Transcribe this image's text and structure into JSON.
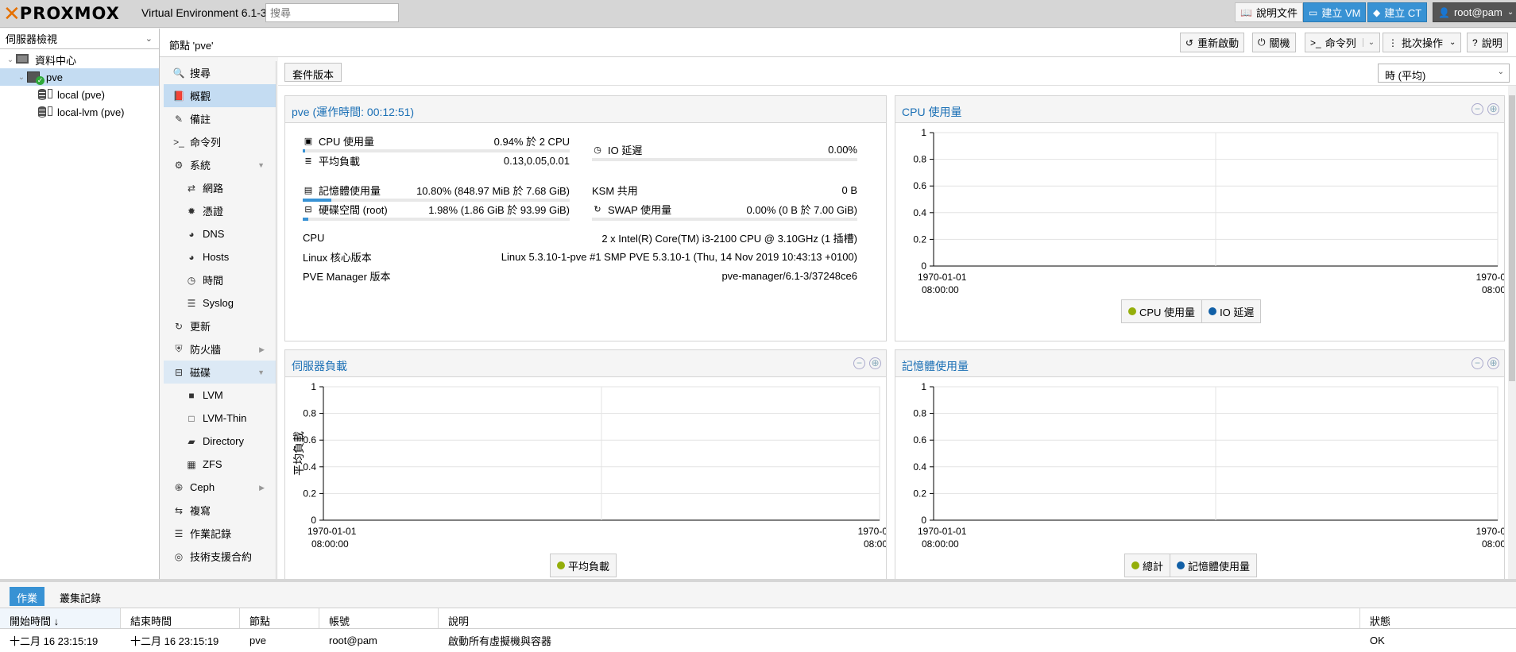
{
  "topbar": {
    "logo_text": "PROXMOX",
    "version": "Virtual Environment 6.1-3",
    "search_placeholder": "搜尋",
    "docs_label": "說明文件",
    "create_vm_label": "建立 VM",
    "create_ct_label": "建立 CT",
    "user_label": "root@pam"
  },
  "tree": {
    "view_label": "伺服器檢視",
    "items": [
      {
        "label": "資料中心"
      },
      {
        "label": "pve"
      },
      {
        "label": "local (pve)"
      },
      {
        "label": "local-lvm (pve)"
      }
    ]
  },
  "header": {
    "title": "節點 'pve'",
    "reboot": "重新啟動",
    "shutdown": "關機",
    "shell": "命令列",
    "bulk": "批次操作",
    "help": "說明"
  },
  "nav": {
    "items": [
      {
        "label": "搜尋",
        "icon": "search-icon"
      },
      {
        "label": "概觀",
        "icon": "book-icon"
      },
      {
        "label": "備註",
        "icon": "note-icon"
      },
      {
        "label": "命令列",
        "icon": "terminal-icon"
      },
      {
        "label": "系統",
        "icon": "cogs-icon"
      },
      {
        "label": "網路",
        "icon": "exchange-icon"
      },
      {
        "label": "憑證",
        "icon": "certificate-icon"
      },
      {
        "label": "DNS",
        "icon": "globe-icon"
      },
      {
        "label": "Hosts",
        "icon": "globe-icon"
      },
      {
        "label": "時間",
        "icon": "clock-icon"
      },
      {
        "label": "Syslog",
        "icon": "list-icon"
      },
      {
        "label": "更新",
        "icon": "refresh-icon"
      },
      {
        "label": "防火牆",
        "icon": "shield-icon"
      },
      {
        "label": "磁碟",
        "icon": "hdd-icon"
      },
      {
        "label": "LVM",
        "icon": "square-icon"
      },
      {
        "label": "LVM-Thin",
        "icon": "square-outline-icon"
      },
      {
        "label": "Directory",
        "icon": "folder-icon"
      },
      {
        "label": "ZFS",
        "icon": "grid-icon"
      },
      {
        "label": "Ceph",
        "icon": "ceph-icon"
      },
      {
        "label": "複寫",
        "icon": "retweet-icon"
      },
      {
        "label": "作業記錄",
        "icon": "list-icon"
      },
      {
        "label": "技術支援合約",
        "icon": "lifering-icon"
      }
    ]
  },
  "content": {
    "package_versions": "套件版本",
    "timeframe": "時 (平均)"
  },
  "summary": {
    "title": "pve (運作時間: 00:12:51)",
    "cpu_label": "CPU 使用量",
    "cpu_value": "0.94% 於 2 CPU",
    "cpu_pct": 0.94,
    "load_label": "平均負載",
    "load_value": "0.13,0.05,0.01",
    "io_label": "IO 延遲",
    "io_value": "0.00%",
    "mem_label": "記憶體使用量",
    "mem_value": "10.80% (848.97 MiB 於 7.68 GiB)",
    "mem_pct": 10.8,
    "ksm_label": "KSM 共用",
    "ksm_value": "0 B",
    "disk_label": "硬碟空間 (root)",
    "disk_value": "1.98% (1.86 GiB 於 93.99 GiB)",
    "disk_pct": 1.98,
    "swap_label": "SWAP 使用量",
    "swap_value": "0.00% (0 B 於 7.00 GiB)",
    "swap_pct": 0,
    "cpu_info_label": "CPU",
    "cpu_info_value": "2 x Intel(R) Core(TM) i3-2100 CPU @ 3.10GHz (1 插槽)",
    "kernel_label": "Linux 核心版本",
    "kernel_value": "Linux 5.3.10-1-pve #1 SMP PVE 5.3.10-1 (Thu, 14 Nov 2019 10:43:13 +0100)",
    "pve_label": "PVE Manager 版本",
    "pve_value": "pve-manager/6.1-3/37248ce6"
  },
  "charts": {
    "cpu": {
      "title": "CPU 使用量",
      "legend": [
        "CPU 使用量",
        "IO 延遲"
      ]
    },
    "load": {
      "title": "伺服器負載",
      "ylabel": "平均負載",
      "legend": [
        "平均負載"
      ]
    },
    "mem": {
      "title": "記憶體使用量",
      "legend": [
        "總計",
        "記憶體使用量"
      ]
    },
    "colors": {
      "green": "#94ae0a",
      "blue": "#115fa6"
    }
  },
  "chart_data": [
    {
      "type": "line",
      "title": "CPU 使用量",
      "ylim": [
        0,
        1
      ],
      "yticks": [
        "0",
        "0.2",
        "0.4",
        "0.6",
        "0.8",
        "1"
      ],
      "x": [
        "1970-01-01 08:00:00",
        "1970-0 08:00"
      ],
      "series": [
        {
          "name": "CPU 使用量",
          "values": []
        },
        {
          "name": "IO 延遲",
          "values": []
        }
      ]
    },
    {
      "type": "line",
      "title": "伺服器負載",
      "ylabel": "平均負載",
      "ylim": [
        0,
        1
      ],
      "yticks": [
        "0",
        "0.2",
        "0.4",
        "0.6",
        "0.8",
        "1"
      ],
      "x": [
        "1970-01-01 08:00:00",
        "1970-0 08:00"
      ],
      "series": [
        {
          "name": "平均負載",
          "values": []
        }
      ]
    },
    {
      "type": "line",
      "title": "記憶體使用量",
      "ylim": [
        0,
        1
      ],
      "yticks": [
        "0",
        "0.2",
        "0.4",
        "0.6",
        "0.8",
        "1"
      ],
      "x": [
        "1970-01-01 08:00:00",
        "1970-0 08:00"
      ],
      "series": [
        {
          "name": "總計",
          "values": []
        },
        {
          "name": "記憶體使用量",
          "values": []
        }
      ]
    }
  ],
  "bottom": {
    "tab_tasks": "作業",
    "tab_cluster": "叢集記錄",
    "columns": [
      "開始時間 ↓",
      "結束時間",
      "節點",
      "帳號",
      "說明",
      "狀態"
    ],
    "rows": [
      [
        "十二月 16 23:15:19",
        "十二月 16 23:15:19",
        "pve",
        "root@pam",
        "啟動所有虛擬機與容器",
        "OK"
      ]
    ]
  }
}
